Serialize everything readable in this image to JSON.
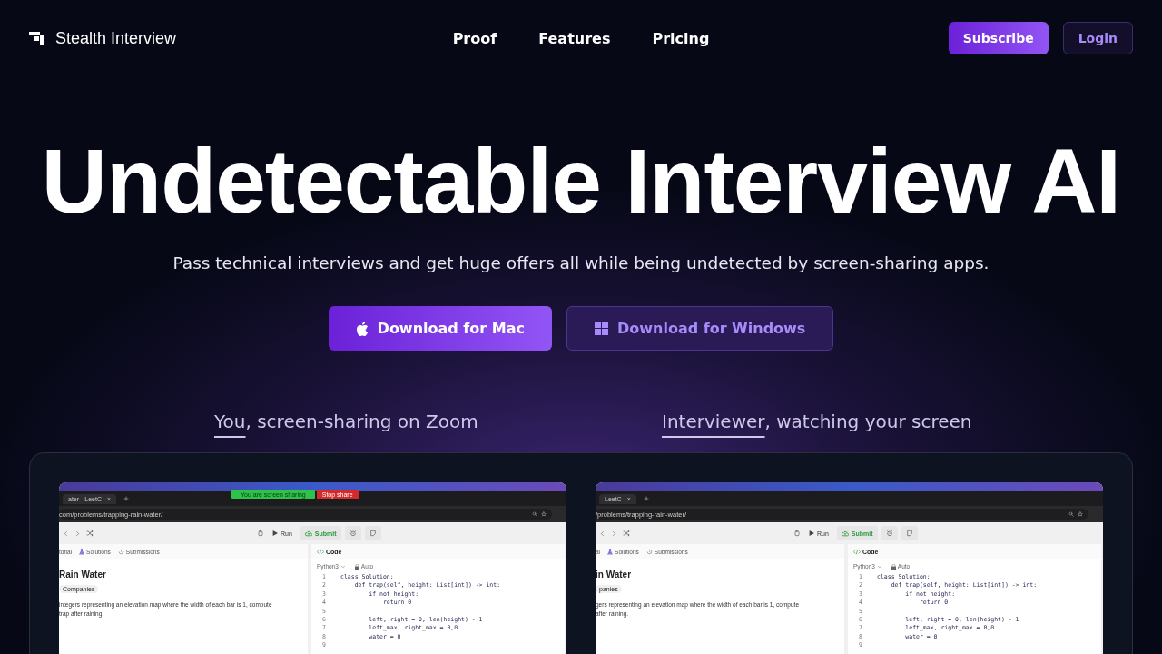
{
  "nav": {
    "brand": "Stealth Interview",
    "links": [
      "Proof",
      "Features",
      "Pricing"
    ],
    "subscribe": "Subscribe",
    "login": "Login"
  },
  "hero": {
    "title": "Undetectable Interview AI",
    "subtitle": "Pass technical interviews and get huge offers all while being undetected by screen-sharing apps.",
    "buttons": [
      {
        "kind": "mac",
        "label": "Download for Mac"
      },
      {
        "kind": "windows",
        "label": "Download for Windows"
      }
    ]
  },
  "captions": [
    {
      "highlight": "You",
      "rest": ", screen-sharing on Zoom"
    },
    {
      "highlight": "Interviewer",
      "rest": ", watching your screen"
    }
  ],
  "screens": [
    {
      "banner": {
        "sharing": "You are screen sharing",
        "stop": "Stop share"
      },
      "tab_title": "ater - LeetC",
      "tab_close": "×",
      "url": "com/problems/trapping-rain-water/",
      "run": "Run",
      "submit": "Submit",
      "left_tabs": [
        "torial",
        "Solutions",
        "Submissions"
      ],
      "problem_title": "Rain Water",
      "tag": "Companies",
      "description": [
        "integers representing an elevation map where the width of each bar is 1, compute",
        "trap after raining."
      ],
      "code_header": "Code",
      "language": "Python3",
      "mode": "Auto",
      "code_lines": [
        {
          "number": "1",
          "text": "class Solution:"
        },
        {
          "number": "2",
          "text": "    def trap(self, height: List[int]) -> int:"
        },
        {
          "number": "3",
          "text": "        if not height:"
        },
        {
          "number": "4",
          "text": "            return 0"
        },
        {
          "number": "5"
        },
        {
          "number": "6",
          "text": "        left, right = 0, len(height) - 1"
        },
        {
          "number": "7",
          "text": "        left_max, right_max = 0,0"
        },
        {
          "number": "8",
          "text": "        water = 0"
        },
        {
          "number": "9"
        }
      ]
    },
    {
      "tab_title": "LeetC",
      "tab_close": "×",
      "url": "/problems/trapping-rain-water/",
      "run": "Run",
      "submit": "Submit",
      "left_tabs": [
        "al",
        "Solutions",
        "Submissions"
      ],
      "problem_title": "in Water",
      "tag": "panies",
      "description": [
        "gers representing an elevation map where the width of each bar is 1, compute",
        "after raining."
      ],
      "code_header": "Code",
      "language": "Python3",
      "mode": "Auto",
      "code_lines": [
        {
          "number": "1",
          "text": "class Solution:"
        },
        {
          "number": "2",
          "text": "    def trap(self, height: List[int]) -> int:"
        },
        {
          "number": "3",
          "text": "        if not height:"
        },
        {
          "number": "4",
          "text": "            return 0"
        },
        {
          "number": "5"
        },
        {
          "number": "6",
          "text": "        left, right = 0, len(height) - 1"
        },
        {
          "number": "7",
          "text": "        left_max, right_max = 0,0"
        },
        {
          "number": "8",
          "text": "        water = 0"
        },
        {
          "number": "9"
        }
      ]
    }
  ]
}
